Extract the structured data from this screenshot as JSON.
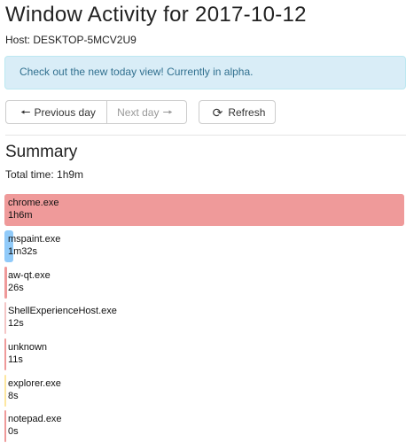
{
  "page": {
    "title": "Window Activity for 2017-10-12",
    "host_label": "Host: DESKTOP-5MCV2U9"
  },
  "alert": {
    "message": "Check out the new today view! Currently in alpha."
  },
  "nav": {
    "previous_label": "Previous day",
    "next_label": "Next day",
    "refresh_label": "Refresh",
    "previous_icon": "arrow-left-icon",
    "next_icon": "arrow-right-icon",
    "refresh_icon": "refresh-icon"
  },
  "summary": {
    "heading": "Summary",
    "total_time": "Total time: 1h9m",
    "max_seconds": 3960,
    "apps": [
      {
        "name": "chrome.exe",
        "duration": "1h6m",
        "seconds": 3960,
        "color": "#ef9a9a"
      },
      {
        "name": "mspaint.exe",
        "duration": "1m32s",
        "seconds": 92,
        "color": "#90caf9"
      },
      {
        "name": "aw-qt.exe",
        "duration": "26s",
        "seconds": 26,
        "color": "#ef9a9a"
      },
      {
        "name": "ShellExperienceHost.exe",
        "duration": "12s",
        "seconds": 12,
        "color": "#f4c6c6"
      },
      {
        "name": "unknown",
        "duration": "11s",
        "seconds": 11,
        "color": "#ef9a9a"
      },
      {
        "name": "explorer.exe",
        "duration": "8s",
        "seconds": 8,
        "color": "#fde7a0"
      },
      {
        "name": "notepad.exe",
        "duration": "0s",
        "seconds": 0,
        "color": "#ef9a9a"
      }
    ]
  }
}
